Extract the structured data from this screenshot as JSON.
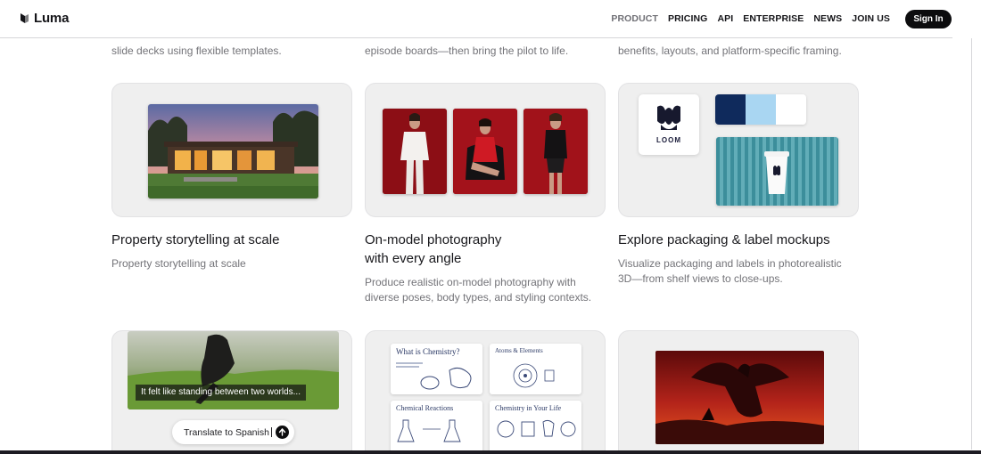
{
  "brand": {
    "name": "Luma"
  },
  "nav": {
    "links": [
      "PRODUCT",
      "PRICING",
      "API",
      "ENTERPRISE",
      "NEWS",
      "JOIN US"
    ],
    "signin": "Sign In"
  },
  "top_descs": [
    "slide decks using flexible templates.",
    "episode boards—then bring the pilot to life.",
    "benefits, layouts, and platform-specific framing."
  ],
  "cards": {
    "property": {
      "title": "Property storytelling at scale",
      "desc": "Property storytelling at scale"
    },
    "on_model": {
      "title_1": "On-model photography",
      "title_2": "with every angle",
      "desc_1": "Produce realistic on-model photography with",
      "desc_2": "diverse poses, body types, and styling contexts."
    },
    "packaging": {
      "title": "Explore packaging & label mockups",
      "desc_1": "Visualize packaging and labels in photorealistic",
      "desc_2": "3D—from shelf views to close-ups.",
      "logo": "LOOM"
    },
    "video": {
      "caption": "It felt like standing between two worlds...",
      "prompt": "Translate to Spanish"
    },
    "chemistry": {
      "t1": "What is Chemistry?",
      "t2": "Atoms & Elements",
      "t3": "Chemical Reactions",
      "t4": "Chemistry in Your Life"
    }
  },
  "colors": {
    "accent": "#0c0c0e",
    "swatch_navy": "#0f2a5c",
    "swatch_sky": "#a9d6f2",
    "swatch_white": "#ffffff"
  }
}
